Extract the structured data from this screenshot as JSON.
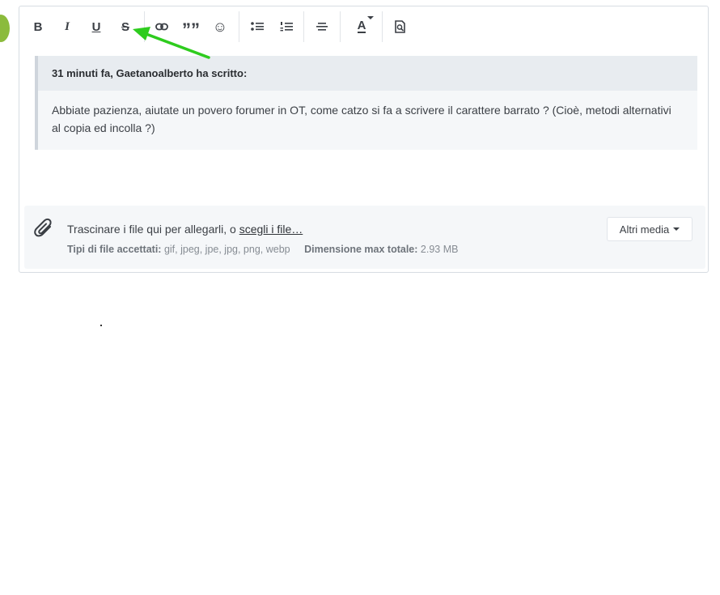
{
  "toolbar": {
    "bold_label": "B",
    "italic_label": "I",
    "underline_label": "U",
    "strike_label": "S",
    "quote_label": "”",
    "emoji_label": "☺",
    "text_color_label": "A",
    "icons": [
      "bold-icon",
      "italic-icon",
      "underline-icon",
      "strikethrough-icon",
      "link-icon",
      "quote-icon",
      "emoji-icon",
      "bullet-list-icon",
      "numbered-list-icon",
      "align-center-icon",
      "text-color-icon",
      "preview-icon"
    ]
  },
  "quote": {
    "header": "31 minuti fa, Gaetanoalberto ha scritto:",
    "body": "Abbiate pazienza, aiutate un povero forumer in OT, come catzo si fa a scrivere il carattere barrato ? (Cioè, metodi alternativi al copia ed incolla ?)"
  },
  "attachments": {
    "drop_prefix": "Trascinare i file qui per allegarli, o ",
    "choose_link": "scegli i file…",
    "accepted_label": "Tipi di file accettati:",
    "accepted_types": "gif, jpeg, jpe, jpg, png, webp",
    "max_size_label": "Dimensione max totale:",
    "max_size_value": "2.93 MB",
    "more_media_button": "Altri media"
  },
  "colors": {
    "arrow": "#2ecc1e",
    "avatar": "#8bbb3c",
    "quote_bg": "#f5f7f9",
    "quote_header_bg": "#e8ecf0"
  }
}
